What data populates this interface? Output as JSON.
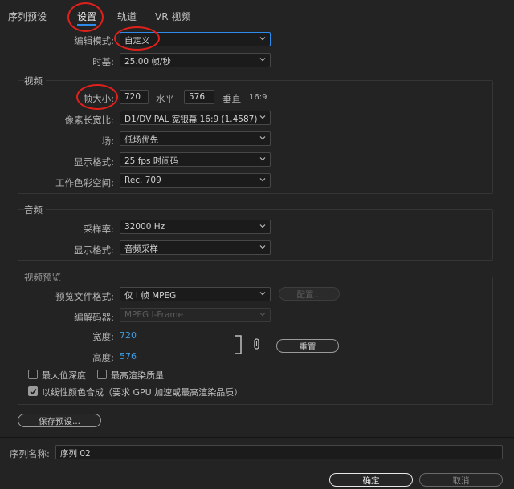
{
  "tabs": [
    {
      "label": "序列预设"
    },
    {
      "label": "设置"
    },
    {
      "label": "轨道"
    },
    {
      "label": "VR 视频"
    }
  ],
  "settings": {
    "edit_mode_label": "编辑模式:",
    "edit_mode_value": "自定义",
    "timebase_label": "时基:",
    "timebase_value": "25.00  帧/秒"
  },
  "video": {
    "title": "视频",
    "frame_size_label": "帧大小:",
    "frame_width": "720",
    "horizontal_label": "水平",
    "frame_height": "576",
    "vertical_label": "垂直",
    "aspect": "16:9",
    "pixel_aspect_label": "像素长宽比:",
    "pixel_aspect_value": "D1/DV PAL 宽银幕 16:9 (1.4587)",
    "field_label": "场:",
    "field_value": "低场优先",
    "display_format_label": "显示格式:",
    "display_format_value": "25 fps 时间码",
    "color_space_label": "工作色彩空间:",
    "color_space_value": "Rec. 709"
  },
  "audio": {
    "title": "音频",
    "sample_rate_label": "采样率:",
    "sample_rate_value": "32000 Hz",
    "display_format_label": "显示格式:",
    "display_format_value": "音频采样"
  },
  "preview": {
    "title": "视频预览",
    "file_format_label": "预览文件格式:",
    "file_format_value": "仅 I 帧 MPEG",
    "configure_label": "配置...",
    "codec_label": "编解码器:",
    "codec_value": "MPEG I-Frame",
    "width_label": "宽度:",
    "width_value": "720",
    "height_label": "高度:",
    "height_value": "576",
    "reset_label": "重置"
  },
  "options": {
    "max_bit_depth": "最大位深度",
    "max_render_quality": "最高渲染质量",
    "linear_color": "以线性颜色合成（要求 GPU 加速或最高渲染品质）"
  },
  "footer": {
    "save_preset_label": "保存预设...",
    "sequence_name_label": "序列名称:",
    "sequence_name_value": "序列 02",
    "ok_label": "确定",
    "cancel_label": "取消"
  },
  "colors": {
    "accent": "#2d8ceb",
    "annotation": "#e0201b",
    "value_blue": "#3f9ce0"
  }
}
